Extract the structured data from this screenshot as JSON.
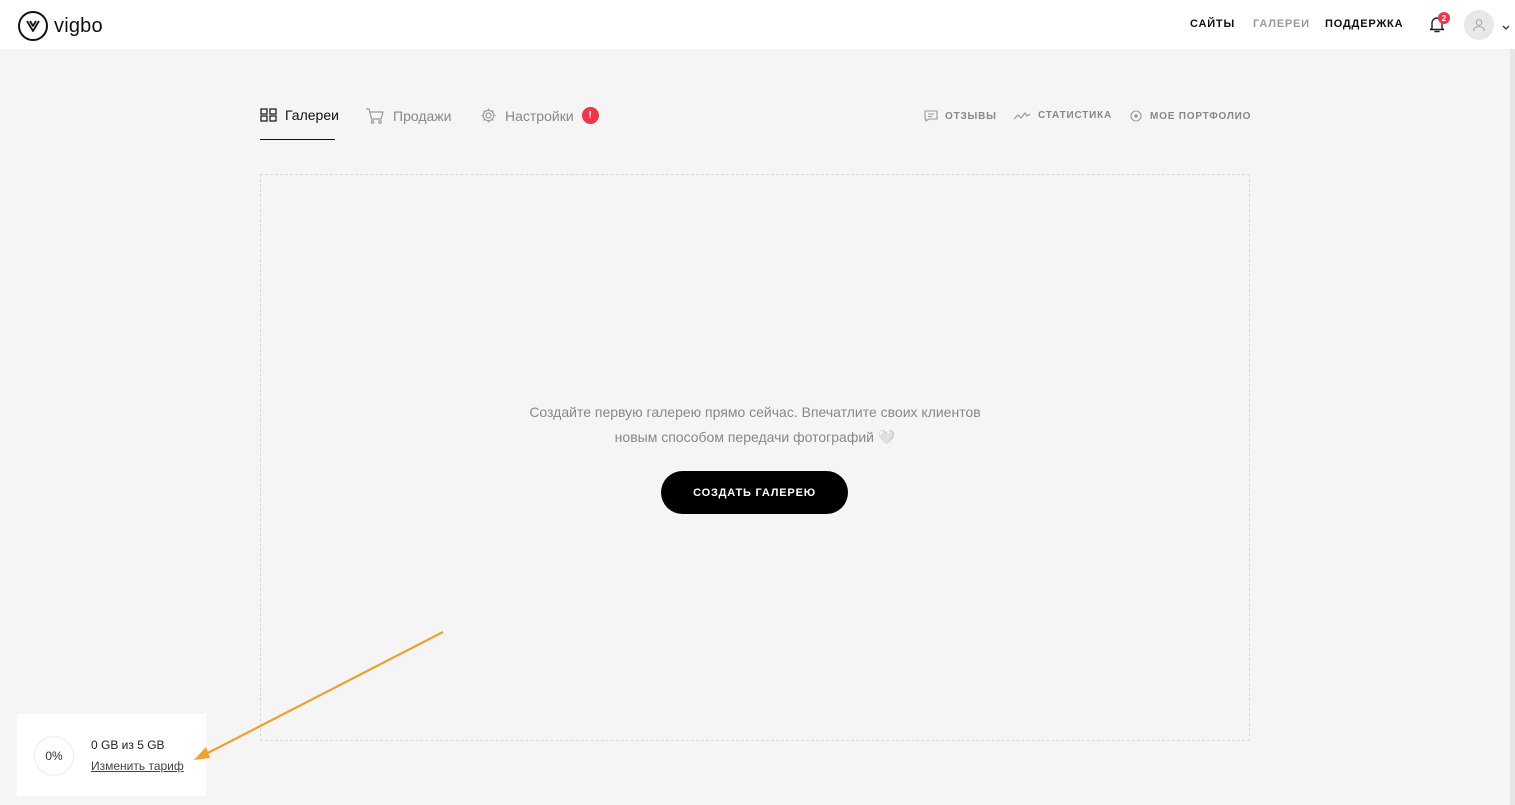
{
  "brand": {
    "name": "vigbo"
  },
  "topnav": {
    "sites": "САЙТЫ",
    "galleries": "ГАЛЕРЕИ",
    "support": "ПОДДЕРЖКА",
    "notification_count": "2"
  },
  "tabs": {
    "galleries": "Галереи",
    "sales": "Продажи",
    "settings": "Настройки",
    "settings_badge": "!"
  },
  "right_links": {
    "reviews": "ОТЗЫВЫ",
    "statistics": "СТАТИСТИКА",
    "portfolio": "МОЕ ПОРТФОЛИО"
  },
  "empty_state": {
    "line1": "Создайте первую галерею прямо сейчас. Впечатлите своих клиентов",
    "line2": "новым способом передачи фотографий 🤍",
    "button": "СОЗДАТЬ ГАЛЕРЕЮ"
  },
  "storage": {
    "percent": "0%",
    "used": "0 GB из 5 GB",
    "change_plan": "Изменить тариф"
  },
  "colors": {
    "accent_badge": "#f0354a",
    "annotation_arrow": "#f0a030"
  },
  "icons": [
    "logo-icon",
    "bell-icon",
    "user-icon",
    "chevron-down-icon",
    "grid-icon",
    "cart-icon",
    "gear-icon",
    "comment-icon",
    "chart-icon",
    "eye-icon"
  ]
}
